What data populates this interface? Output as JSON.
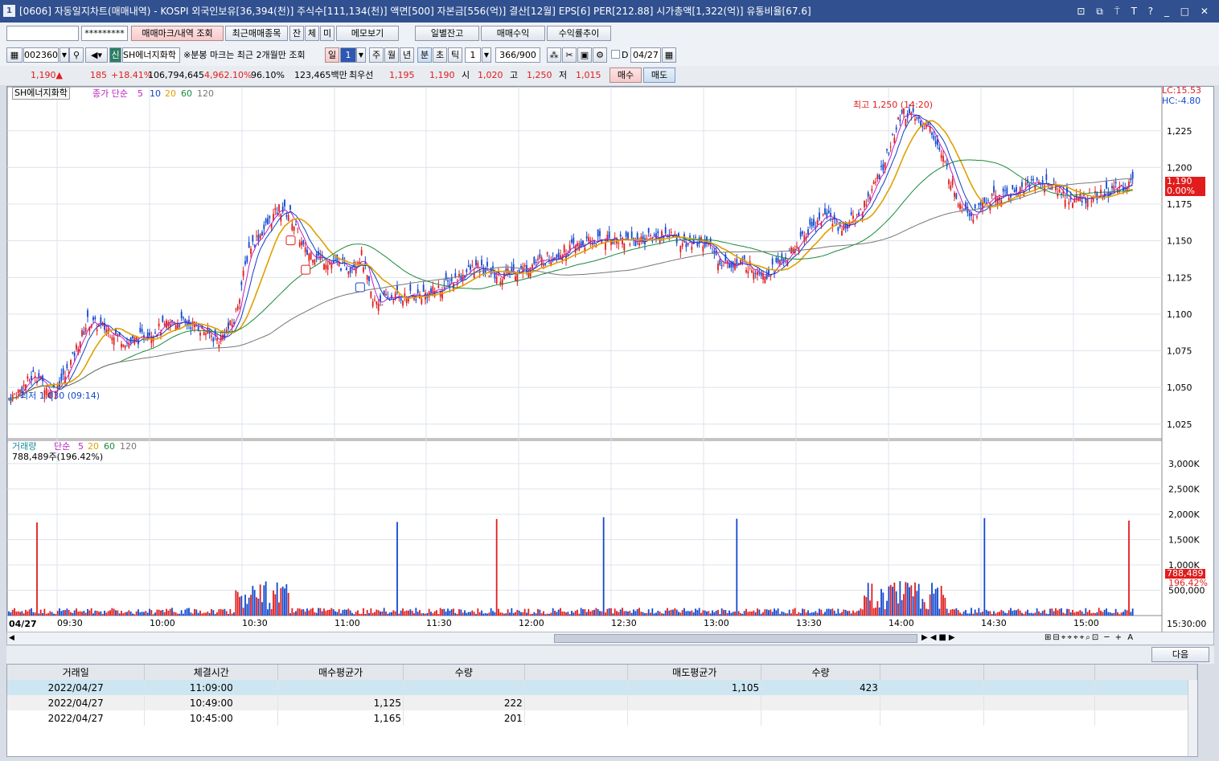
{
  "window": {
    "id": "1",
    "title": "[0606] 자동일지차트(매매내역) - KOSPI 외국인보유[36,394(천)] 주식수[111,134(천)] 액면[500] 자본금[556(억)] 결산[12월] EPS[6] PER[212.88] 시가총액[1,322(억)] 유통비율[67.6]",
    "controls": "⊡ ⧉ ⍑ T ? _ □ ✕"
  },
  "toolbar1": {
    "account": "",
    "password": "*********",
    "btn_markings": "매매마크/내역 조회",
    "btn_recent": "최근매매종목",
    "btn_jan": "잔",
    "btn_che": "체",
    "btn_mi": "미",
    "btn_memo": "메모보기",
    "btn_daily": "일별잔고",
    "btn_profit": "매매수익",
    "btn_trend": "수익률추이"
  },
  "toolbar2": {
    "code": "002360",
    "stock_badge": "신",
    "stock_name": "SH에너지화학",
    "note": "※분봉 마크는 최근 2개월만 조회",
    "period_il": "일",
    "period_val": "1",
    "period_ju": "주",
    "period_wol": "월",
    "period_nyeon": "년",
    "period_bun": "분",
    "period_cho": "초",
    "period_tick": "틱",
    "interval": "1",
    "count": "366/900",
    "d_label": "D",
    "date": "04/27"
  },
  "quote": {
    "price": "1,190▲",
    "change": "185",
    "pct": "+18.41%",
    "volume": "106,794,645",
    "vol_pct": "4,962.10%",
    "strength": "96.10%",
    "amount": "123,465백만",
    "bid_label": "최우선",
    "bid": "1,195",
    "ask": "1,190",
    "open_l": "시",
    "open": "1,020",
    "high_l": "고",
    "high": "1,250",
    "low_l": "저",
    "low": "1,015",
    "buy": "매수",
    "sell": "매도"
  },
  "price_panel": {
    "name": "SH에너지화학",
    "legend": {
      "label": "종가 단순",
      "p5": "5",
      "p10": "10",
      "p20": "20",
      "p60": "60",
      "p120": "120"
    },
    "lc": "LC:15.53",
    "hc": "HC:-4.80",
    "high_note": "최고 1,250 (14:20)",
    "low_note": "최저 1,030 (09:14)",
    "price_tag": "1,190",
    "pct_tag": "0.00%",
    "ticks": [
      "1,225",
      "1,200",
      "1,175",
      "1,150",
      "1,125",
      "1,100",
      "1,075",
      "1,050",
      "1,025"
    ]
  },
  "volume_panel": {
    "label": "거래량",
    "legend_label": "단순",
    "p5": "5",
    "p20": "20",
    "p60": "60",
    "p120": "120",
    "current": "788,489주(196.42%)",
    "tag": "788,489",
    "tag_pct": "196.42%",
    "ticks": [
      "3,000K",
      "2,500K",
      "2,000K",
      "1,500K",
      "1,000K",
      "500,000"
    ]
  },
  "time_axis": {
    "date": "04/27",
    "ticks": [
      "09:30",
      "10:00",
      "10:30",
      "11:00",
      "11:30",
      "12:00",
      "12:30",
      "13:00",
      "13:30",
      "14:00",
      "14:30",
      "15:00"
    ],
    "end": "15:30:00"
  },
  "grid": {
    "next_btn": "다음",
    "headers": [
      "거래일",
      "체결시간",
      "매수평균가",
      "수량",
      "",
      "매도평균가",
      "수량",
      "",
      "",
      ""
    ],
    "rows": [
      [
        "2022/04/27",
        "11:09:00",
        "",
        "",
        "",
        "1,105",
        "423",
        "",
        "",
        ""
      ],
      [
        "2022/04/27",
        "10:49:00",
        "1,125",
        "222",
        "",
        "",
        "",
        "",
        "",
        ""
      ],
      [
        "2022/04/27",
        "10:45:00",
        "1,165",
        "201",
        "",
        "",
        "",
        "",
        "",
        ""
      ]
    ]
  },
  "chart_data": {
    "type": "candlestick",
    "series_anchor": [
      [
        0,
        1042
      ],
      [
        6,
        1048
      ],
      [
        14,
        1060
      ],
      [
        22,
        1046
      ],
      [
        30,
        1058
      ],
      [
        42,
        1095
      ],
      [
        52,
        1090
      ],
      [
        64,
        1080
      ],
      [
        76,
        1088
      ],
      [
        90,
        1095
      ],
      [
        100,
        1092
      ],
      [
        112,
        1082
      ],
      [
        120,
        1095
      ],
      [
        128,
        1145
      ],
      [
        136,
        1158
      ],
      [
        144,
        1172
      ],
      [
        150,
        1168
      ],
      [
        158,
        1142
      ],
      [
        164,
        1140
      ],
      [
        172,
        1135
      ],
      [
        182,
        1132
      ],
      [
        188,
        1140
      ],
      [
        194,
        1108
      ],
      [
        206,
        1112
      ],
      [
        216,
        1112
      ],
      [
        226,
        1115
      ],
      [
        236,
        1122
      ],
      [
        248,
        1132
      ],
      [
        262,
        1126
      ],
      [
        276,
        1132
      ],
      [
        290,
        1140
      ],
      [
        306,
        1148
      ],
      [
        320,
        1152
      ],
      [
        336,
        1150
      ],
      [
        350,
        1155
      ],
      [
        362,
        1148
      ],
      [
        370,
        1150
      ],
      [
        380,
        1135
      ],
      [
        392,
        1134
      ],
      [
        404,
        1128
      ],
      [
        416,
        1140
      ],
      [
        428,
        1160
      ],
      [
        436,
        1168
      ],
      [
        444,
        1158
      ],
      [
        454,
        1170
      ],
      [
        464,
        1195
      ],
      [
        470,
        1215
      ],
      [
        476,
        1238
      ],
      [
        484,
        1233
      ],
      [
        492,
        1225
      ],
      [
        498,
        1205
      ],
      [
        506,
        1178
      ],
      [
        514,
        1168
      ],
      [
        522,
        1178
      ],
      [
        534,
        1182
      ],
      [
        546,
        1190
      ],
      [
        556,
        1188
      ],
      [
        566,
        1178
      ],
      [
        580,
        1180
      ],
      [
        599,
        1190
      ]
    ],
    "ylim": [
      1015,
      1255
    ],
    "high": 1250,
    "low": 1030
  }
}
